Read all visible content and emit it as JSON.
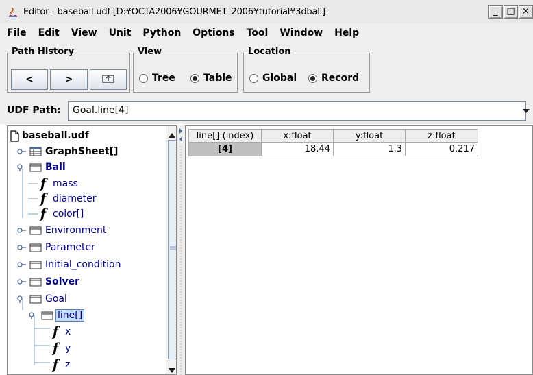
{
  "window": {
    "title": "Editor - baseball.udf [D:¥OCTA2006¥GOURMET_2006¥tutorial¥3dball]",
    "minimize_label": "_",
    "maximize_label": "□",
    "close_label": "×"
  },
  "menu": [
    "File",
    "Edit",
    "View",
    "Unit",
    "Python",
    "Options",
    "Tool",
    "Window",
    "Help"
  ],
  "path_history": {
    "title": "Path History",
    "back_label": "<",
    "forward_label": ">"
  },
  "view": {
    "title": "View",
    "options": [
      "Tree",
      "Table"
    ],
    "selected": "Table"
  },
  "location": {
    "title": "Location",
    "options": [
      "Global",
      "Record"
    ],
    "selected": "Record"
  },
  "udf_path": {
    "label": "UDF Path:",
    "value": "Goal.line[4]"
  },
  "tree": {
    "root": "baseball.udf",
    "items": [
      {
        "label": "GraphSheet[]",
        "kind": "table-node"
      },
      {
        "label": "Ball",
        "kind": "folder-expanded"
      },
      {
        "label": "mass",
        "kind": "field"
      },
      {
        "label": "diameter",
        "kind": "field"
      },
      {
        "label": "color[]",
        "kind": "field"
      },
      {
        "label": "Environment",
        "kind": "folder"
      },
      {
        "label": "Parameter",
        "kind": "folder"
      },
      {
        "label": "Initial_condition",
        "kind": "folder"
      },
      {
        "label": "Solver",
        "kind": "folder"
      },
      {
        "label": "Goal",
        "kind": "folder-expanded"
      },
      {
        "label": "line[]",
        "kind": "folder-expanded-selected"
      },
      {
        "label": "x",
        "kind": "field"
      },
      {
        "label": "y",
        "kind": "field"
      },
      {
        "label": "z",
        "kind": "field"
      }
    ]
  },
  "table": {
    "columns": [
      "line[]:(index)",
      "x:float",
      "y:float",
      "z:float"
    ],
    "rows": [
      [
        "[4]",
        "18.44",
        "1.3",
        "0.217"
      ]
    ]
  }
}
